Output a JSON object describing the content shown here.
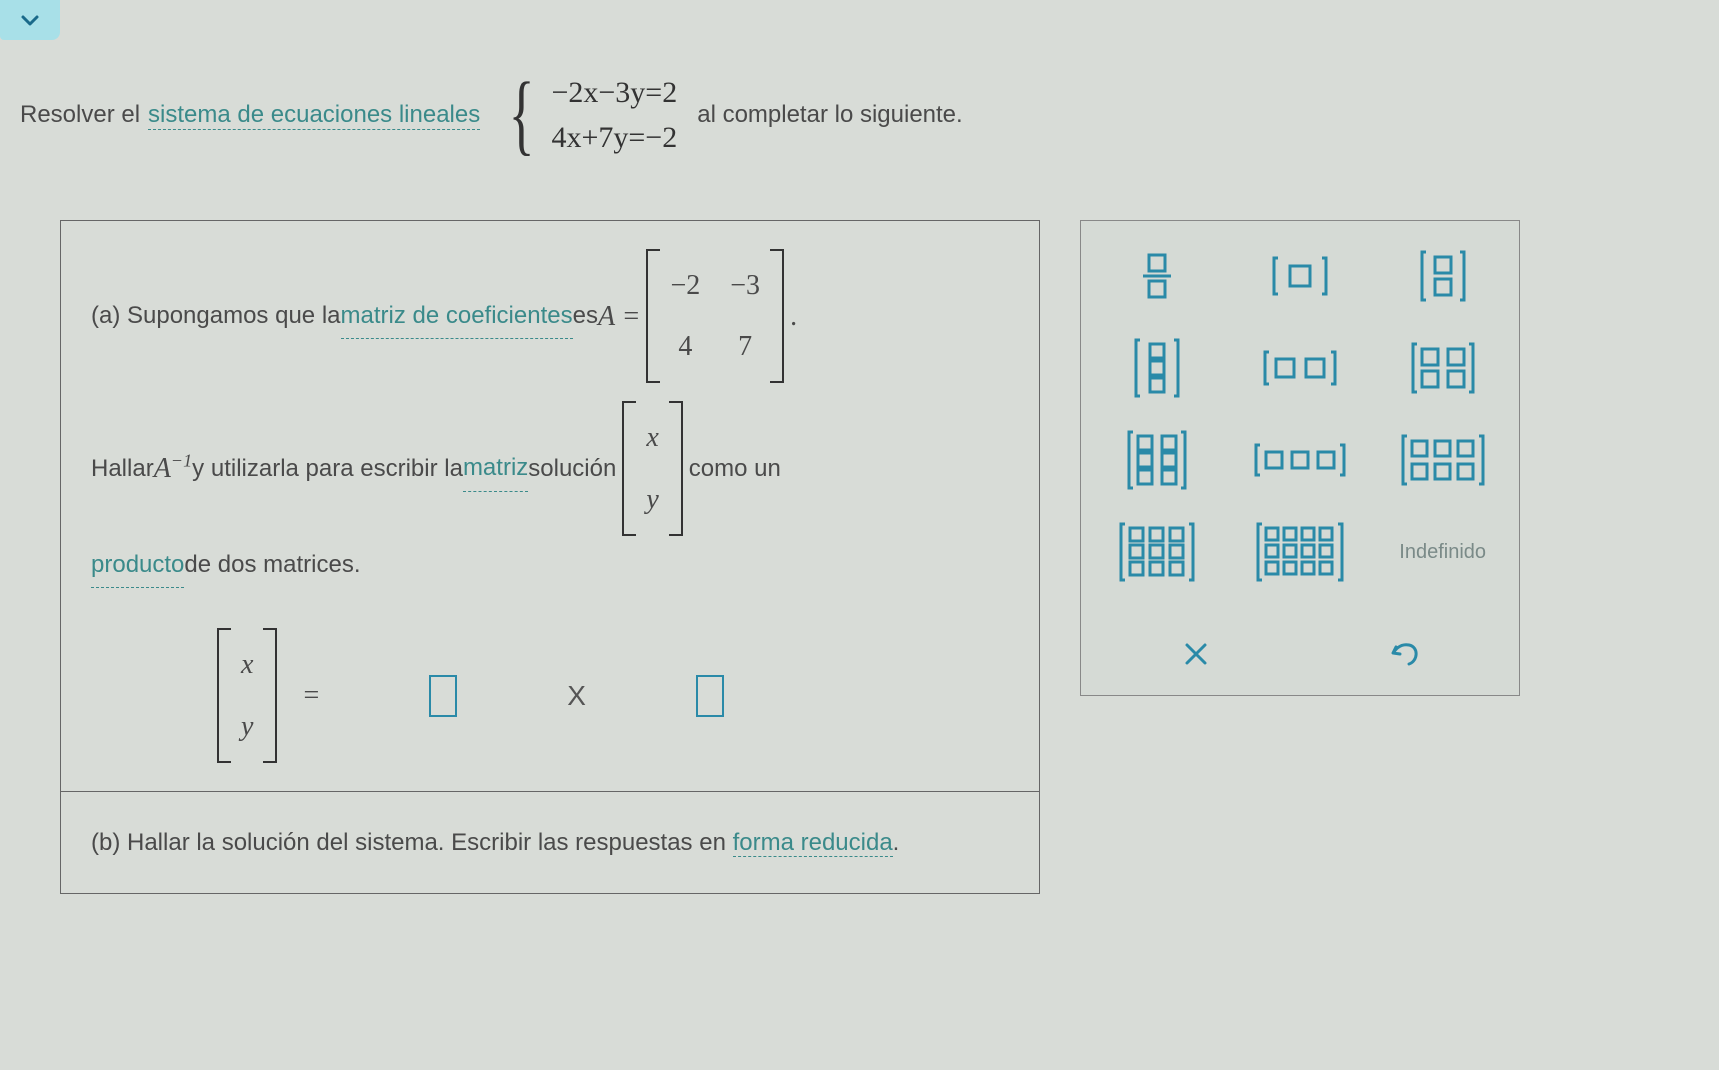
{
  "prompt": {
    "lead": "Resolver el ",
    "link": "sistema de ecuaciones lineales",
    "eq1": "−2x−3y=2",
    "eq2": "4x+7y=−2",
    "trail": " al completar lo siguiente."
  },
  "part_a": {
    "label": "(a) Supongamos que la ",
    "link1": "matriz de coeficientes",
    "mid1": " es ",
    "a_eq": "A =",
    "matrixA": {
      "r1c1": "−2",
      "r1c2": "−3",
      "r2c1": "4",
      "r2c2": "7"
    },
    "dot": ".",
    "line2a": "Hallar ",
    "a_inv": "A",
    "a_inv_sup": "−1",
    "line2b": " y utilizarla para escribir la ",
    "link2": "matriz",
    "line2c": " solución ",
    "xy": {
      "r1": "x",
      "r2": "y"
    },
    "line2d": " como un",
    "link3": "producto",
    "line3b": " de dos matrices.",
    "answer_xy": {
      "r1": "x",
      "r2": "y"
    },
    "eqsign": "=",
    "times": "X"
  },
  "part_b": {
    "text": "(b) Hallar la solución del sistema. Escribir las respuestas en ",
    "link": "forma reducida",
    "dot": "."
  },
  "palette": {
    "undef": "Indefinido"
  }
}
